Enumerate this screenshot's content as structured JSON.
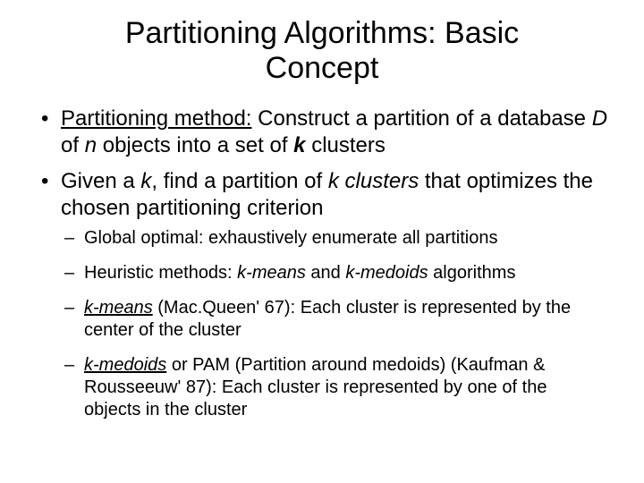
{
  "title_l1": "Partitioning Algorithms: Basic",
  "title_l2": "Concept",
  "b1_a": "Partitioning method:",
  "b1_b": " Construct a partition of a database ",
  "b1_c": "D",
  "b1_d": " of ",
  "b1_e": "n",
  "b1_f": " objects into a set of ",
  "b1_g": "k",
  "b1_h": " clusters",
  "b2_a": "Given a ",
  "b2_b": "k",
  "b2_c": ", find a partition of ",
  "b2_d": "k clusters",
  "b2_e": " that optimizes the chosen partitioning criterion",
  "s1": "Global optimal: exhaustively enumerate all partitions",
  "s2_a": "Heuristic methods: ",
  "s2_b": "k-means",
  "s2_c": " and ",
  "s2_d": "k-medoids",
  "s2_e": " algorithms",
  "s3_a": "k-means",
  "s3_b": " (Mac.Queen' 67): Each cluster is represented by the center of the cluster",
  "s4_a": "k-medoids",
  "s4_b": " or PAM (Partition around medoids) (Kaufman & Rousseeuw' 87): Each cluster is represented by one of the objects in the cluster"
}
